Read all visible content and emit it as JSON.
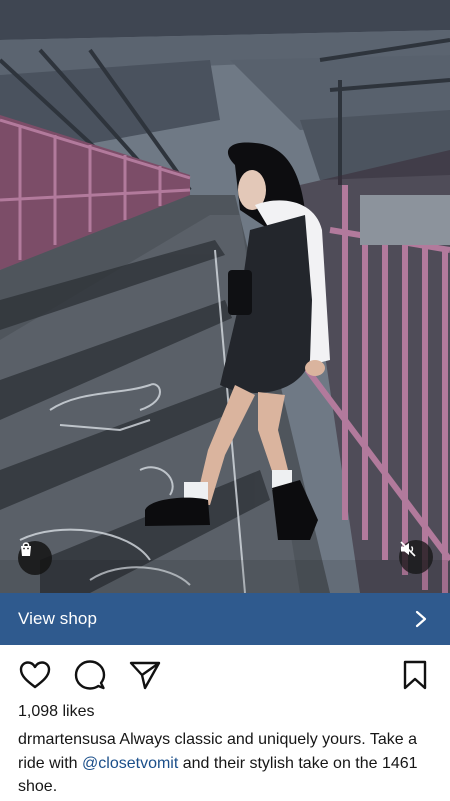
{
  "photo": {
    "alt_subject": "",
    "shop_tag_icon": "shopping-bag-icon",
    "mute_icon": "speaker-muted-icon"
  },
  "shop_bar": {
    "label": "View shop",
    "chevron_icon": "chevron-right-icon"
  },
  "actions": {
    "like_icon": "heart-icon",
    "comment_icon": "comment-icon",
    "share_icon": "paper-plane-icon",
    "save_icon": "bookmark-icon"
  },
  "post": {
    "likes": "1,098 likes",
    "username": "drmartensusa",
    "caption_part1": "Always classic and uniquely yours. Take a ride with",
    "mention": "@closetvomit",
    "caption_part2": "and their stylish take on the 1461 shoe."
  },
  "colors": {
    "shop_bar_bg": "#2f5a8e",
    "mention": "#1b4f8a",
    "railing": "#b27a9c"
  }
}
